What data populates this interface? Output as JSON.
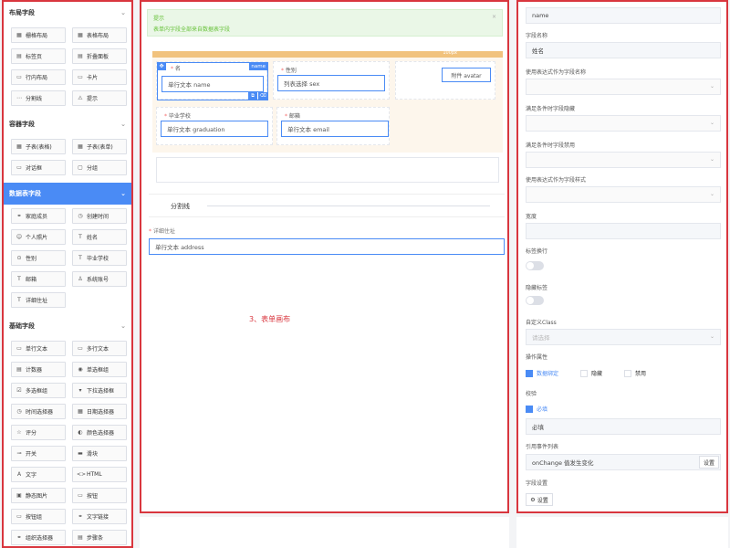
{
  "left": {
    "sections": [
      {
        "title": "布局字段",
        "items": [
          {
            "icon": "▦",
            "label": "栅格布局"
          },
          {
            "icon": "▦",
            "label": "表格布局"
          },
          {
            "icon": "▤",
            "label": "标签页"
          },
          {
            "icon": "▤",
            "label": "折叠面板"
          },
          {
            "icon": "▭",
            "label": "行内布局"
          },
          {
            "icon": "▭",
            "label": "卡片"
          },
          {
            "icon": "⋯",
            "label": "分割线"
          },
          {
            "icon": "⚠",
            "label": "提示"
          }
        ]
      },
      {
        "title": "容器字段",
        "items": [
          {
            "icon": "▦",
            "label": "子表(表格)"
          },
          {
            "icon": "▦",
            "label": "子表(表单)"
          },
          {
            "icon": "▭",
            "label": "对话框"
          },
          {
            "icon": "▢",
            "label": "分组"
          }
        ]
      },
      {
        "title": "数据表字段",
        "items": [
          {
            "icon": "⚭",
            "label": "家庭成员"
          },
          {
            "icon": "◷",
            "label": "创建时间"
          },
          {
            "icon": "☺",
            "label": "个人照片"
          },
          {
            "icon": "T",
            "label": "姓名"
          },
          {
            "icon": "⊙",
            "label": "性别"
          },
          {
            "icon": "T",
            "label": "毕业学校"
          },
          {
            "icon": "T",
            "label": "邮箱"
          },
          {
            "icon": "♙",
            "label": "系统账号"
          },
          {
            "icon": "T",
            "label": "详细住址"
          }
        ]
      },
      {
        "title": "基础字段",
        "items": [
          {
            "icon": "▭",
            "label": "单行文本"
          },
          {
            "icon": "▭",
            "label": "多行文本"
          },
          {
            "icon": "▤",
            "label": "计数器"
          },
          {
            "icon": "◉",
            "label": "单选框组"
          },
          {
            "icon": "☑",
            "label": "多选框组"
          },
          {
            "icon": "▾",
            "label": "下拉选择框"
          },
          {
            "icon": "◷",
            "label": "时间选择器"
          },
          {
            "icon": "▦",
            "label": "日期选择器"
          },
          {
            "icon": "☆",
            "label": "评分"
          },
          {
            "icon": "◐",
            "label": "颜色选择器"
          },
          {
            "icon": "⊸",
            "label": "开关"
          },
          {
            "icon": "▬",
            "label": "滑块"
          },
          {
            "icon": "A",
            "label": "文字"
          },
          {
            "icon": "<>",
            "label": "HTML"
          },
          {
            "icon": "▣",
            "label": "静态图片"
          },
          {
            "icon": "▭",
            "label": "按钮"
          },
          {
            "icon": "▭",
            "label": "按钮组"
          },
          {
            "icon": "⚭",
            "label": "文字链接"
          },
          {
            "icon": "⚭",
            "label": "组织选择器"
          },
          {
            "icon": "▤",
            "label": "步骤条"
          }
        ]
      }
    ]
  },
  "center": {
    "alert_title": "提示",
    "alert_desc": "表单内字段全部来自数据表字段",
    "alert_close": "×",
    "bar_label": "100px",
    "name_label": "名",
    "name_tag": "name",
    "name_value": "单行文本 name",
    "sex_label": "性别",
    "sex_value": "列表选择 sex",
    "avatar_value": "附件 avatar",
    "grad_label": "毕业学校",
    "grad_value": "单行文本 graduation",
    "email_label": "邮箱",
    "email_value": "单行文本 email",
    "divider_text": "分割线",
    "addr_label": "详细住址",
    "addr_value": "单行文本 address",
    "canvas_note": "3、表单画布"
  },
  "right": {
    "field_id_value": "name",
    "field_name_label": "字段名称",
    "field_name_value": "姓名",
    "expr_name_label": "使用表达式作为字段名称",
    "hide_cond_label": "满足条件时字段隐藏",
    "disable_cond_label": "满足条件时字段禁用",
    "expr_style_label": "使用表达式作为字段样式",
    "width_label": "宽度",
    "label_wrap_label": "标签换行",
    "hide_label_label": "隐藏标签",
    "class_label": "自定义Class",
    "class_placeholder": "请选择",
    "ops_label": "操作属性",
    "ops": [
      {
        "label": "数据绑定",
        "checked": true
      },
      {
        "label": "隐藏",
        "checked": false
      },
      {
        "label": "禁用",
        "checked": false
      }
    ],
    "validate_label": "校验",
    "required_label": "必填",
    "required_msg": "必填",
    "events_label": "引用事件列表",
    "event_value": "onChange 值发生变化",
    "event_btn": "设置",
    "field_settings_label": "字段设置",
    "field_settings_btn": "设置",
    "check_mark": "✓",
    "dropdown_arrow": "⌄"
  }
}
